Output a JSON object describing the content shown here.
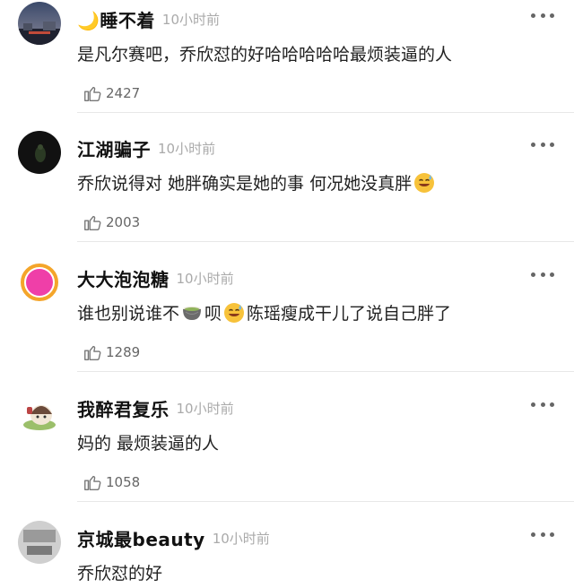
{
  "comments": [
    {
      "username": "🌙睡不着",
      "time": "10小时前",
      "text": "是凡尔赛吧，乔欣怼的好哈哈哈哈哈最烦装逼的人",
      "likes": "2427",
      "avatar_icon": "night-sky-avatar"
    },
    {
      "username": "江湖骗子",
      "time": "10小时前",
      "text_before": "乔欣说得对 她胖确实是她的事 何况她没真胖",
      "emoji_1": "sweat-smile-emoji",
      "likes": "2003",
      "avatar_icon": "dark-photo-avatar"
    },
    {
      "username": "大大泡泡糖",
      "time": "10小时前",
      "text_part_1": "谁也别说谁不",
      "emoji_1": "tea-cup-emoji",
      "text_part_2": "呗",
      "emoji_2": "sweat-smile-emoji",
      "text_part_3": "陈瑶瘦成干儿了说自己胖了",
      "likes": "1289",
      "avatar_icon": "pink-ring-avatar"
    },
    {
      "username": "我醉君复乐",
      "time": "10小时前",
      "text": "妈的 最烦装逼的人",
      "likes": "1058",
      "avatar_icon": "cartoon-avatar"
    },
    {
      "username": "京城最beauty",
      "time": "10小时前",
      "text": "乔欣怼的好",
      "avatar_icon": "grey-photo-avatar"
    }
  ],
  "colors": {
    "username": "#111111",
    "time": "#aaaaaa",
    "likes": "#666666",
    "divider": "#e8e8e8"
  }
}
